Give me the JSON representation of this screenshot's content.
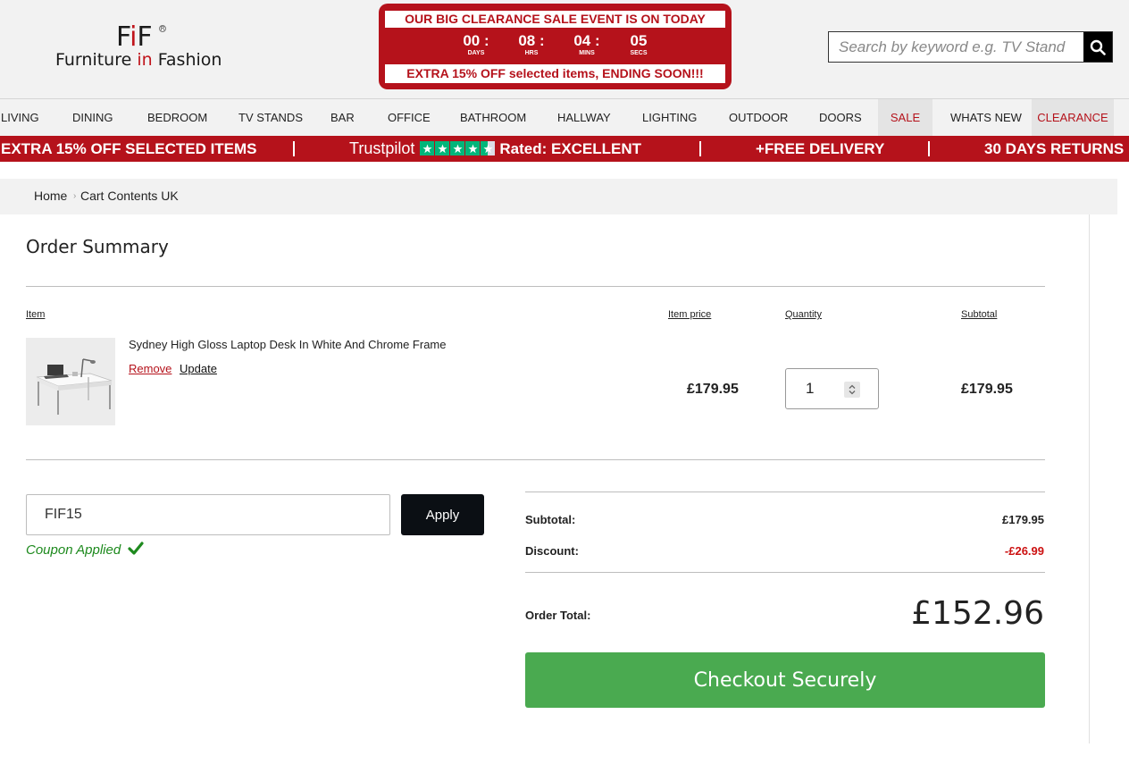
{
  "header": {
    "logo_mark": "FiF",
    "logo_text_1": "Furniture",
    "logo_text_in": "in",
    "logo_text_2": "Fashion",
    "sale_title": "OUR BIG CLEARANCE SALE EVENT IS ON TODAY",
    "countdown": [
      {
        "value": "00",
        "label": "DAYS"
      },
      {
        "value": "08",
        "label": "HRS"
      },
      {
        "value": "04",
        "label": "MINS"
      },
      {
        "value": "05",
        "label": "SECS"
      }
    ],
    "sale_subtitle": "EXTRA 15% OFF selected items, ENDING SOON!!!",
    "search_placeholder": "Search by keyword e.g. TV Stand"
  },
  "nav": {
    "items": [
      "LIVING",
      "DINING",
      "BEDROOM",
      "TV STANDS",
      "BAR",
      "OFFICE",
      "BATHROOM",
      "HALLWAY",
      "LIGHTING",
      "OUTDOOR",
      "DOORS",
      "SALE",
      "WHATS NEW",
      "CLEARANCE"
    ]
  },
  "promo": {
    "extra": "EXTRA 15% OFF SELECTED ITEMS",
    "trustpilot": "Trustpilot",
    "rated": "Rated: EXCELLENT",
    "delivery": "+FREE DELIVERY",
    "returns": "30 DAYS RETURNS",
    "star_color": "#00b67a",
    "rating_stars": 4.5
  },
  "breadcrumb": {
    "home": "Home",
    "current": "Cart Contents UK"
  },
  "order": {
    "title": "Order Summary",
    "col_item": "Item",
    "col_price": "Item price",
    "col_qty": "Quantity",
    "col_subtotal": "Subtotal",
    "product_name": "Sydney High Gloss Laptop Desk In White And Chrome Frame",
    "remove_label": "Remove",
    "update_label": "Update",
    "item_price": "£179.95",
    "quantity": "1",
    "item_subtotal": "£179.95"
  },
  "coupon": {
    "value": "FIF15",
    "apply_label": "Apply",
    "status": "Coupon Applied"
  },
  "summary": {
    "subtotal_label": "Subtotal:",
    "subtotal_value": "£179.95",
    "discount_label": "Discount:",
    "discount_value": "-£26.99",
    "total_label": "Order Total:",
    "total_value": "£152.96",
    "checkout_label": "Checkout Securely"
  },
  "colors": {
    "brand_red": "#b5121b",
    "checkout_green": "#4aaa50",
    "discount_red": "#cc1111"
  }
}
